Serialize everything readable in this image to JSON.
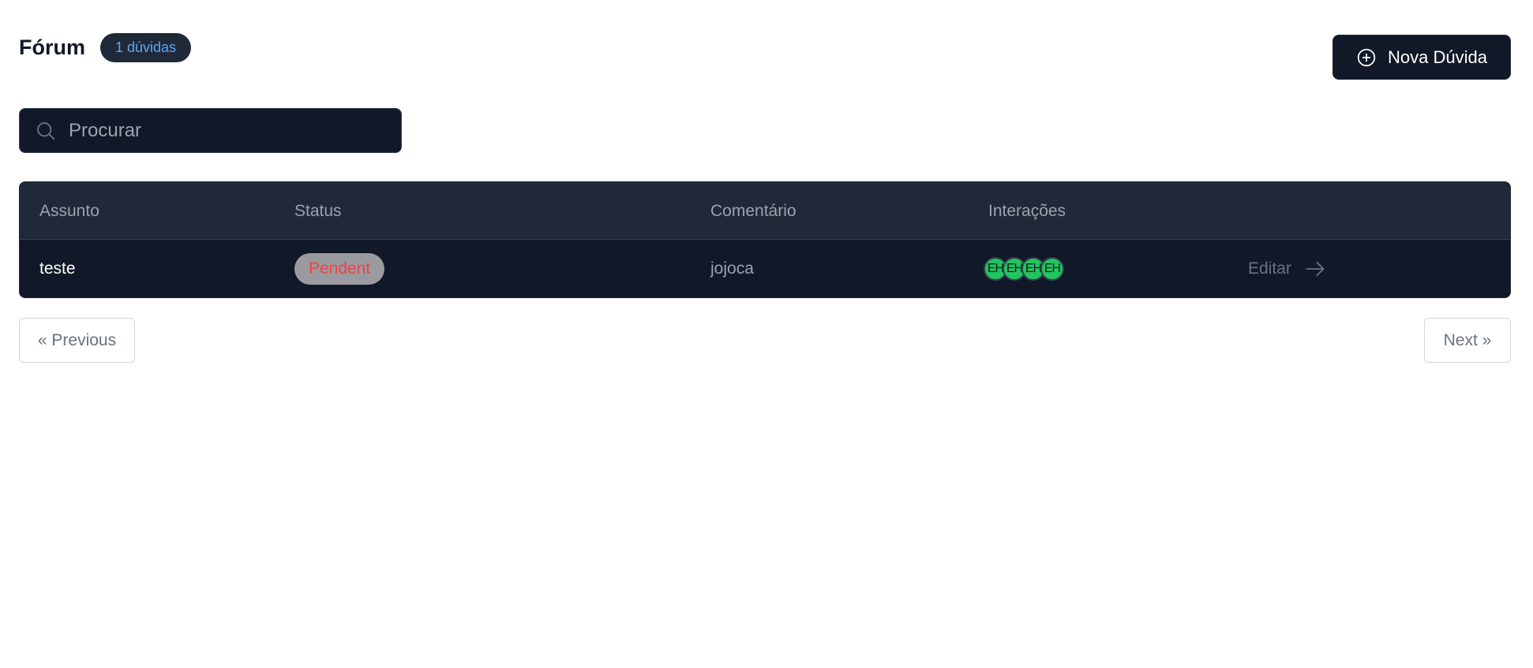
{
  "header": {
    "title": "Fórum",
    "count_badge": "1 dúvidas"
  },
  "new_button": {
    "label": "Nova Dúvida",
    "icon": "plus-circle-icon"
  },
  "search": {
    "placeholder": "Procurar",
    "value": "",
    "icon": "search-icon"
  },
  "table": {
    "columns": [
      "Assunto",
      "Status",
      "Comentário",
      "Interações",
      ""
    ],
    "rows": [
      {
        "subject": "teste",
        "status": "Pendent",
        "comment": "jojoca",
        "interactions": [
          "EH",
          "EH",
          "EH",
          "EH"
        ],
        "action": "Editar"
      }
    ]
  },
  "pagination": {
    "previous": "« Previous",
    "next": "Next »"
  },
  "colors": {
    "dark": "#111827",
    "header_bg": "#1f2937",
    "badge_text": "#60a5fa",
    "status_text": "#ef4444",
    "avatar_bg": "#22c55e"
  }
}
